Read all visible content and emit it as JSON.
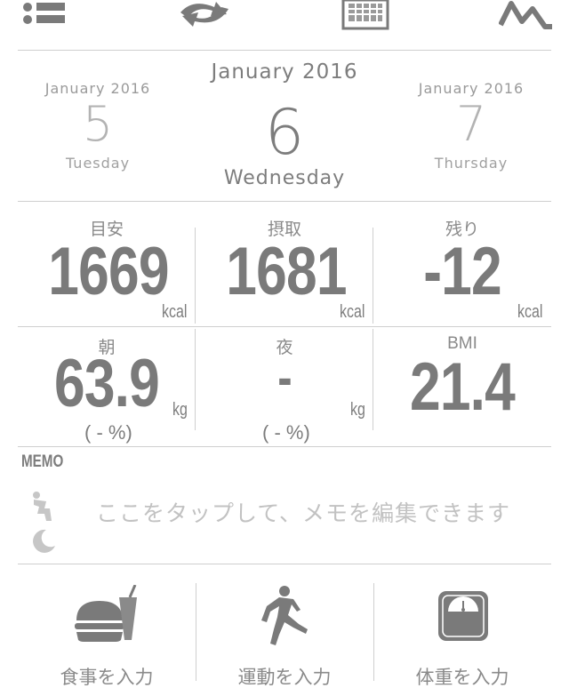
{
  "toolbar": {
    "icons": [
      "menu-icon",
      "sync-icon",
      "calendar-icon",
      "graph-icon"
    ]
  },
  "dates": {
    "prev": {
      "month": "January 2016",
      "day": "5",
      "weekday": "Tuesday"
    },
    "current": {
      "month": "January 2016",
      "day": "6",
      "weekday": "Wednesday"
    },
    "next": {
      "month": "January 2016",
      "day": "7",
      "weekday": "Thursday"
    }
  },
  "calories": {
    "target": {
      "label": "目安",
      "value": "1669",
      "unit": "kcal"
    },
    "intake": {
      "label": "摂取",
      "value": "1681",
      "unit": "kcal"
    },
    "remaining": {
      "label": "残り",
      "value": "-12",
      "unit": "kcal"
    }
  },
  "weight": {
    "morning": {
      "label": "朝",
      "value": "63.9",
      "unit": "kg",
      "body_fat": "( - %)"
    },
    "night": {
      "label": "夜",
      "value": "-",
      "unit": "kg",
      "body_fat": "( - %)"
    },
    "bmi": {
      "label": "BMI",
      "value": "21.4"
    }
  },
  "memo": {
    "title": "MEMO",
    "placeholder": "ここをタップして、メモを編集できます",
    "icons": [
      "person-bending-icon",
      "crescent-moon-icon"
    ]
  },
  "actions": [
    {
      "label": "食事を入力",
      "icon": "burger-drink-icon"
    },
    {
      "label": "運動を入力",
      "icon": "running-man-icon"
    },
    {
      "label": "体重を入力",
      "icon": "scale-icon"
    }
  ],
  "colors": {
    "text": "#7d7d7d",
    "divider": "#cfcfcf",
    "placeholder": "#c2c2c2"
  }
}
